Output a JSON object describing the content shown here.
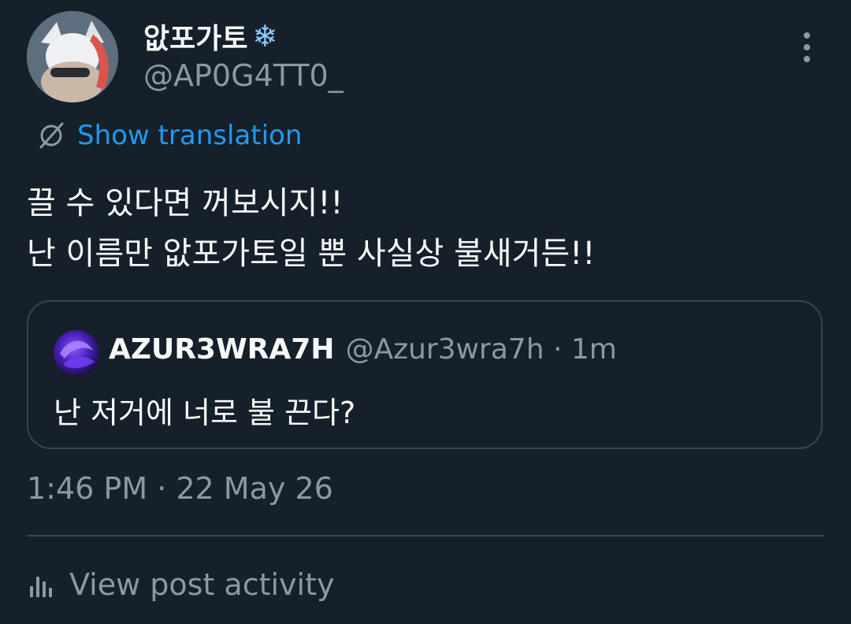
{
  "author": {
    "display_name": "앖포가토",
    "name_emoji": "❄",
    "handle": "@AP0G4TT0_"
  },
  "translation": {
    "label": "Show translation"
  },
  "tweet": {
    "lines": [
      "끌 수 있다면 꺼보시지!!",
      "난 이름만 앖포가토일 뿐 사실상 불새거든!!"
    ]
  },
  "quote": {
    "display_name": "AZUR3WRA7H",
    "meta": "@Azur3wra7h · 1m",
    "text": "난 저거에 너로 불 끈다?"
  },
  "timestamp": "1:46 PM · 22 May 26",
  "activity": {
    "label": "View post activity"
  },
  "colors": {
    "background": "#15202b",
    "text_primary": "#f7f9f9",
    "text_secondary": "#8b98a5",
    "link": "#1d9bf0",
    "border": "#38444d"
  },
  "icons": {
    "more": "more-vertical-icon",
    "translate": "globe-slash-icon",
    "activity": "bar-chart-icon",
    "name_badge": "snowflake-icon"
  }
}
